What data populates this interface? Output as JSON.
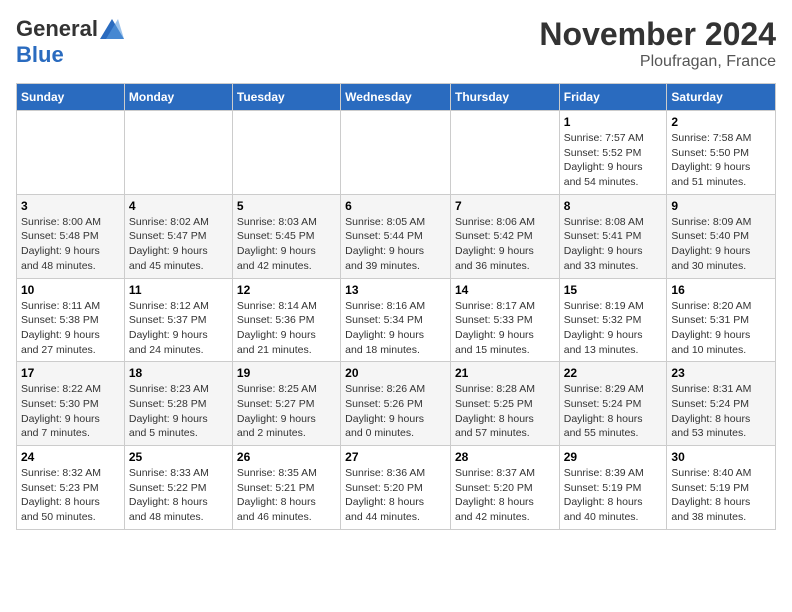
{
  "logo": {
    "general": "General",
    "blue": "Blue"
  },
  "title": "November 2024",
  "location": "Ploufragan, France",
  "days_of_week": [
    "Sunday",
    "Monday",
    "Tuesday",
    "Wednesday",
    "Thursday",
    "Friday",
    "Saturday"
  ],
  "weeks": [
    [
      {
        "day": "",
        "info": ""
      },
      {
        "day": "",
        "info": ""
      },
      {
        "day": "",
        "info": ""
      },
      {
        "day": "",
        "info": ""
      },
      {
        "day": "",
        "info": ""
      },
      {
        "day": "1",
        "info": "Sunrise: 7:57 AM\nSunset: 5:52 PM\nDaylight: 9 hours\nand 54 minutes."
      },
      {
        "day": "2",
        "info": "Sunrise: 7:58 AM\nSunset: 5:50 PM\nDaylight: 9 hours\nand 51 minutes."
      }
    ],
    [
      {
        "day": "3",
        "info": "Sunrise: 8:00 AM\nSunset: 5:48 PM\nDaylight: 9 hours\nand 48 minutes."
      },
      {
        "day": "4",
        "info": "Sunrise: 8:02 AM\nSunset: 5:47 PM\nDaylight: 9 hours\nand 45 minutes."
      },
      {
        "day": "5",
        "info": "Sunrise: 8:03 AM\nSunset: 5:45 PM\nDaylight: 9 hours\nand 42 minutes."
      },
      {
        "day": "6",
        "info": "Sunrise: 8:05 AM\nSunset: 5:44 PM\nDaylight: 9 hours\nand 39 minutes."
      },
      {
        "day": "7",
        "info": "Sunrise: 8:06 AM\nSunset: 5:42 PM\nDaylight: 9 hours\nand 36 minutes."
      },
      {
        "day": "8",
        "info": "Sunrise: 8:08 AM\nSunset: 5:41 PM\nDaylight: 9 hours\nand 33 minutes."
      },
      {
        "day": "9",
        "info": "Sunrise: 8:09 AM\nSunset: 5:40 PM\nDaylight: 9 hours\nand 30 minutes."
      }
    ],
    [
      {
        "day": "10",
        "info": "Sunrise: 8:11 AM\nSunset: 5:38 PM\nDaylight: 9 hours\nand 27 minutes."
      },
      {
        "day": "11",
        "info": "Sunrise: 8:12 AM\nSunset: 5:37 PM\nDaylight: 9 hours\nand 24 minutes."
      },
      {
        "day": "12",
        "info": "Sunrise: 8:14 AM\nSunset: 5:36 PM\nDaylight: 9 hours\nand 21 minutes."
      },
      {
        "day": "13",
        "info": "Sunrise: 8:16 AM\nSunset: 5:34 PM\nDaylight: 9 hours\nand 18 minutes."
      },
      {
        "day": "14",
        "info": "Sunrise: 8:17 AM\nSunset: 5:33 PM\nDaylight: 9 hours\nand 15 minutes."
      },
      {
        "day": "15",
        "info": "Sunrise: 8:19 AM\nSunset: 5:32 PM\nDaylight: 9 hours\nand 13 minutes."
      },
      {
        "day": "16",
        "info": "Sunrise: 8:20 AM\nSunset: 5:31 PM\nDaylight: 9 hours\nand 10 minutes."
      }
    ],
    [
      {
        "day": "17",
        "info": "Sunrise: 8:22 AM\nSunset: 5:30 PM\nDaylight: 9 hours\nand 7 minutes."
      },
      {
        "day": "18",
        "info": "Sunrise: 8:23 AM\nSunset: 5:28 PM\nDaylight: 9 hours\nand 5 minutes."
      },
      {
        "day": "19",
        "info": "Sunrise: 8:25 AM\nSunset: 5:27 PM\nDaylight: 9 hours\nand 2 minutes."
      },
      {
        "day": "20",
        "info": "Sunrise: 8:26 AM\nSunset: 5:26 PM\nDaylight: 9 hours\nand 0 minutes."
      },
      {
        "day": "21",
        "info": "Sunrise: 8:28 AM\nSunset: 5:25 PM\nDaylight: 8 hours\nand 57 minutes."
      },
      {
        "day": "22",
        "info": "Sunrise: 8:29 AM\nSunset: 5:24 PM\nDaylight: 8 hours\nand 55 minutes."
      },
      {
        "day": "23",
        "info": "Sunrise: 8:31 AM\nSunset: 5:24 PM\nDaylight: 8 hours\nand 53 minutes."
      }
    ],
    [
      {
        "day": "24",
        "info": "Sunrise: 8:32 AM\nSunset: 5:23 PM\nDaylight: 8 hours\nand 50 minutes."
      },
      {
        "day": "25",
        "info": "Sunrise: 8:33 AM\nSunset: 5:22 PM\nDaylight: 8 hours\nand 48 minutes."
      },
      {
        "day": "26",
        "info": "Sunrise: 8:35 AM\nSunset: 5:21 PM\nDaylight: 8 hours\nand 46 minutes."
      },
      {
        "day": "27",
        "info": "Sunrise: 8:36 AM\nSunset: 5:20 PM\nDaylight: 8 hours\nand 44 minutes."
      },
      {
        "day": "28",
        "info": "Sunrise: 8:37 AM\nSunset: 5:20 PM\nDaylight: 8 hours\nand 42 minutes."
      },
      {
        "day": "29",
        "info": "Sunrise: 8:39 AM\nSunset: 5:19 PM\nDaylight: 8 hours\nand 40 minutes."
      },
      {
        "day": "30",
        "info": "Sunrise: 8:40 AM\nSunset: 5:19 PM\nDaylight: 8 hours\nand 38 minutes."
      }
    ]
  ]
}
